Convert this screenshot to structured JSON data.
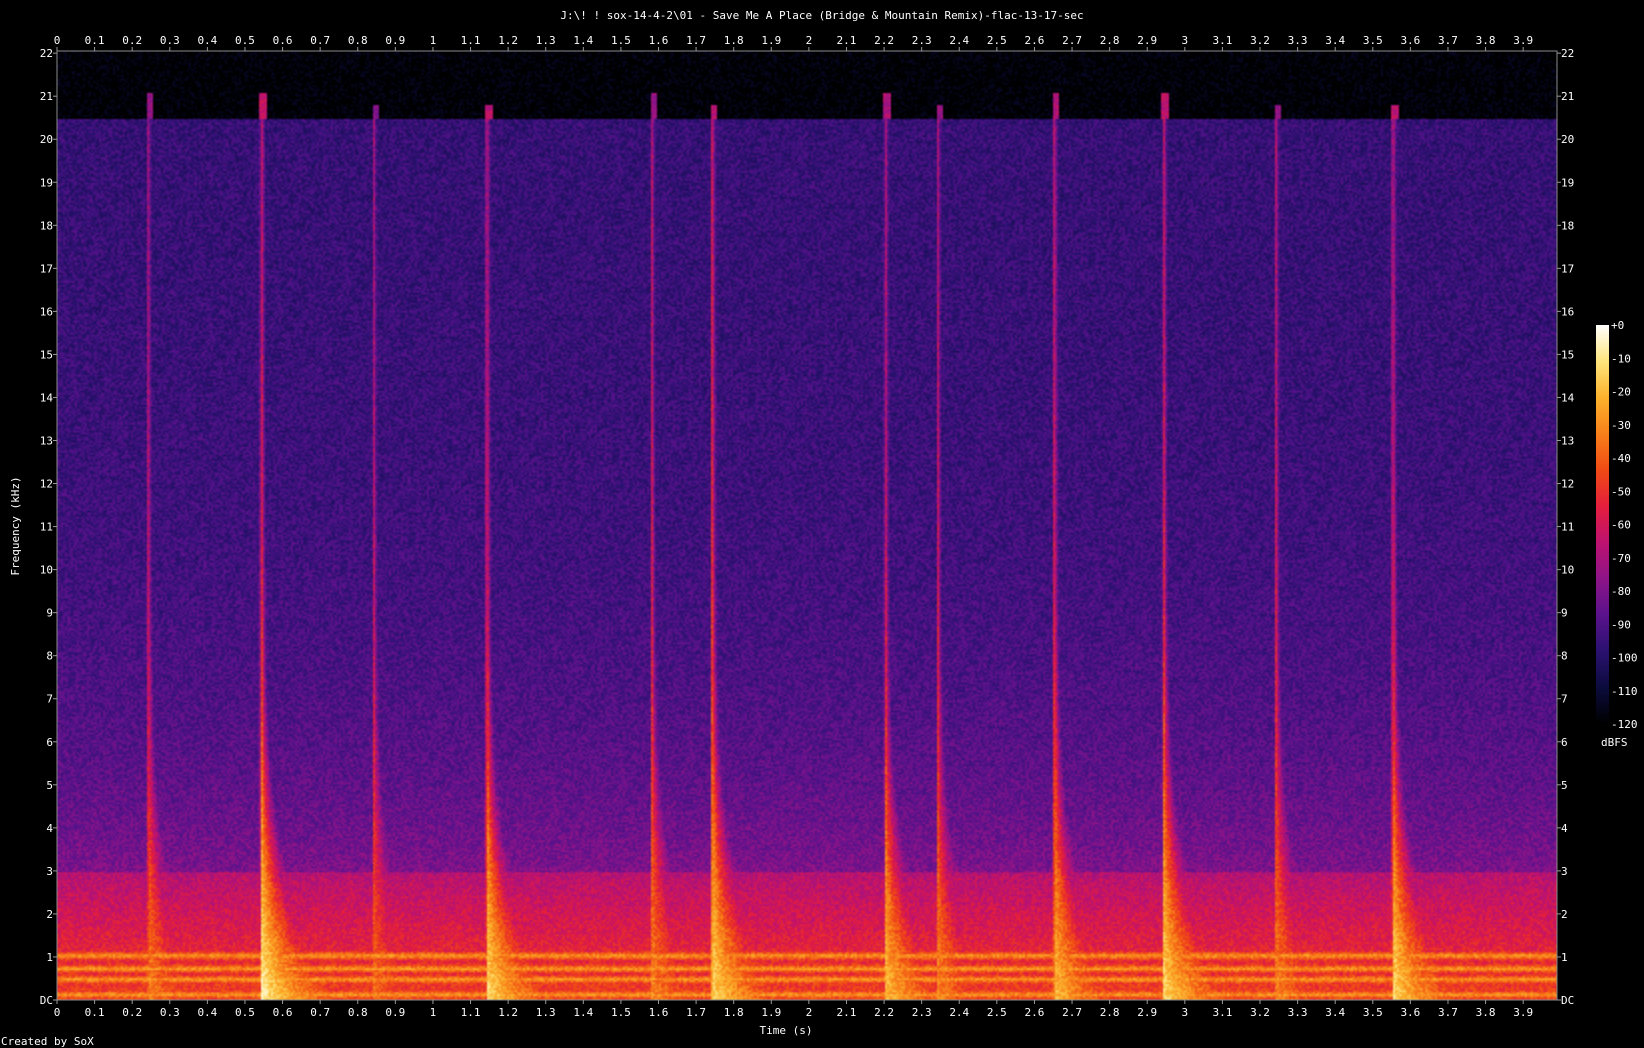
{
  "chart_data": {
    "type": "heatmap",
    "title": "J:\\! ! sox-14-4-2\\01 - Save Me A Place (Bridge & Mountain Remix)-flac-13-17-sec",
    "xlabel": "Time (s)",
    "ylabel": "Frequency (kHz)",
    "xlim": [
      0,
      3.99
    ],
    "ylim": [
      0,
      22.05
    ],
    "x_ticks": [
      "0",
      "0.1",
      "0.2",
      "0.3",
      "0.4",
      "0.5",
      "0.6",
      "0.7",
      "0.8",
      "0.9",
      "1",
      "1.1",
      "1.2",
      "1.3",
      "1.4",
      "1.5",
      "1.6",
      "1.7",
      "1.8",
      "1.9",
      "2",
      "2.1",
      "2.2",
      "2.3",
      "2.4",
      "2.5",
      "2.6",
      "2.7",
      "2.8",
      "2.9",
      "3",
      "3.1",
      "3.2",
      "3.3",
      "3.4",
      "3.5",
      "3.6",
      "3.7",
      "3.8",
      "3.9"
    ],
    "x_tick_values": [
      0,
      0.1,
      0.2,
      0.3,
      0.4,
      0.5,
      0.6,
      0.7,
      0.8,
      0.9,
      1,
      1.1,
      1.2,
      1.3,
      1.4,
      1.5,
      1.6,
      1.7,
      1.8,
      1.9,
      2,
      2.1,
      2.2,
      2.3,
      2.4,
      2.5,
      2.6,
      2.7,
      2.8,
      2.9,
      3,
      3.1,
      3.2,
      3.3,
      3.4,
      3.5,
      3.6,
      3.7,
      3.8,
      3.9
    ],
    "y_ticks": [
      "DC",
      "1",
      "2",
      "3",
      "4",
      "5",
      "6",
      "7",
      "8",
      "9",
      "10",
      "11",
      "12",
      "13",
      "14",
      "15",
      "16",
      "17",
      "18",
      "19",
      "20",
      "21",
      "22"
    ],
    "y_tick_values": [
      0,
      1,
      2,
      3,
      4,
      5,
      6,
      7,
      8,
      9,
      10,
      11,
      12,
      13,
      14,
      15,
      16,
      17,
      18,
      19,
      20,
      21,
      22
    ],
    "colorbar": {
      "label": "dBFS",
      "ticks": [
        "+0",
        "-10",
        "-20",
        "-30",
        "-40",
        "-50",
        "-60",
        "-70",
        "-80",
        "-90",
        "-100",
        "-110",
        "-120"
      ],
      "tick_values": [
        0,
        -10,
        -20,
        -30,
        -40,
        -50,
        -60,
        -70,
        -80,
        -90,
        -100,
        -110,
        -120
      ],
      "range": [
        -120,
        0
      ],
      "colors": [
        "#000000",
        "#0b0b3c",
        "#2a1170",
        "#5a128c",
        "#8d1488",
        "#be1270",
        "#e41e3c",
        "#f04a14",
        "#f8801a",
        "#fcb22c",
        "#fee57c",
        "#ffffff"
      ]
    },
    "background_noise_level_dBFS": -100,
    "lowpass_cutoff_khz": 20.5,
    "transients": [
      {
        "t": 0.24,
        "peak_khz": 20.8,
        "strength": 0.75
      },
      {
        "t": 0.54,
        "peak_khz": 20.8,
        "strength": 0.95
      },
      {
        "t": 0.84,
        "peak_khz": 20.5,
        "strength": 0.7
      },
      {
        "t": 1.14,
        "peak_khz": 20.5,
        "strength": 0.9
      },
      {
        "t": 1.58,
        "peak_khz": 20.8,
        "strength": 0.75
      },
      {
        "t": 1.74,
        "peak_khz": 20.5,
        "strength": 0.9
      },
      {
        "t": 2.2,
        "peak_khz": 20.8,
        "strength": 0.85
      },
      {
        "t": 2.34,
        "peak_khz": 20.5,
        "strength": 0.75
      },
      {
        "t": 2.65,
        "peak_khz": 20.8,
        "strength": 0.85
      },
      {
        "t": 2.94,
        "peak_khz": 20.8,
        "strength": 0.9
      },
      {
        "t": 3.24,
        "peak_khz": 20.5,
        "strength": 0.75
      },
      {
        "t": 3.55,
        "peak_khz": 20.5,
        "strength": 0.9
      }
    ],
    "low_bands_khz": [
      0.15,
      0.5,
      0.75,
      1.05
    ]
  },
  "footer": {
    "credit": "Created by SoX"
  }
}
